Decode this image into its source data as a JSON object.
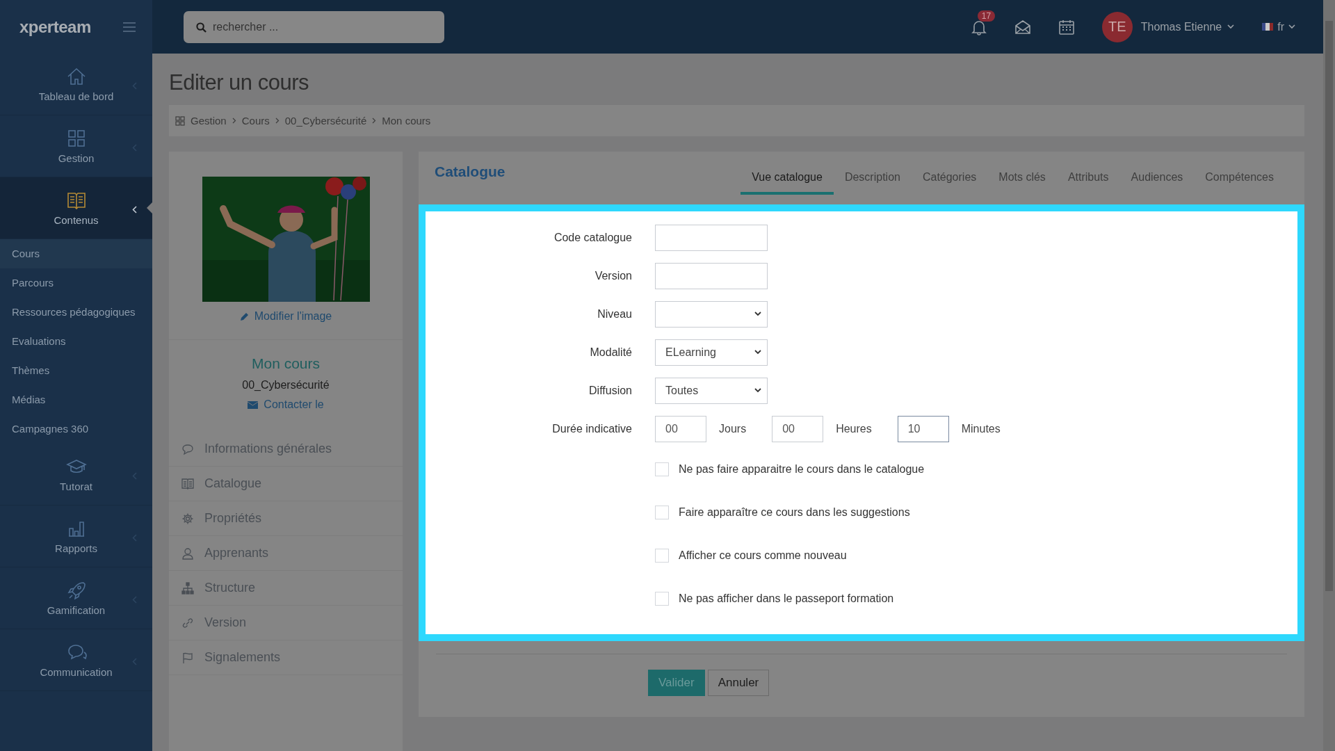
{
  "topbar": {
    "logo": "xperteam",
    "search": {
      "placeholder": "rechercher ..."
    },
    "notifications": "17",
    "user": {
      "initials": "TE",
      "name": "Thomas Etienne"
    },
    "language": "fr"
  },
  "sidebar": {
    "items": [
      {
        "label": "Tableau de bord",
        "expanded": false
      },
      {
        "label": "Gestion",
        "expanded": false
      },
      {
        "label": "Contenus",
        "expanded": true,
        "children": [
          {
            "label": "Cours",
            "selected": true
          },
          {
            "label": "Parcours",
            "selected": false
          },
          {
            "label": "Ressources pédagogiques",
            "selected": false
          },
          {
            "label": "Evaluations",
            "selected": false
          },
          {
            "label": "Thèmes",
            "selected": false
          },
          {
            "label": "Médias",
            "selected": false
          },
          {
            "label": "Campagnes 360",
            "selected": false
          }
        ]
      },
      {
        "label": "Tutorat",
        "expanded": false
      },
      {
        "label": "Rapports",
        "expanded": false
      },
      {
        "label": "Gamification",
        "expanded": false
      },
      {
        "label": "Communication",
        "expanded": false
      }
    ]
  },
  "page": {
    "title": "Editer un cours",
    "breadcrumb": [
      "Gestion",
      "Cours",
      "00_Cybersécurité",
      "Mon cours"
    ]
  },
  "course_card": {
    "edit_link": "Modifier l'image",
    "title": "Mon cours",
    "category": "00_Cybersécurité",
    "contact": "Contacter le",
    "menu": [
      "Informations générales",
      "Catalogue",
      "Propriétés",
      "Apprenants",
      "Structure",
      "Version",
      "Signalements"
    ]
  },
  "panel": {
    "heading": "Catalogue",
    "highlighted": true,
    "tabs": [
      {
        "label": "Vue catalogue",
        "selected": true
      },
      {
        "label": "Description",
        "selected": false
      },
      {
        "label": "Catégories",
        "selected": false
      },
      {
        "label": "Mots clés",
        "selected": false
      },
      {
        "label": "Attributs",
        "selected": false
      },
      {
        "label": "Audiences",
        "selected": false
      },
      {
        "label": "Compétences",
        "selected": false
      }
    ],
    "fields": [
      {
        "kind": "text",
        "label": "Code catalogue"
      },
      {
        "kind": "text",
        "label": "Version"
      },
      {
        "kind": "select",
        "label": "Niveau"
      },
      {
        "kind": "select",
        "label": "Modalité",
        "value": "ELearning"
      },
      {
        "kind": "select",
        "label": "Diffusion",
        "value": "Toutes"
      },
      {
        "kind": "duration",
        "label": "Durée indicative",
        "parts": [
          {
            "value": "00",
            "unit": "Jours"
          },
          {
            "value": "00",
            "unit": "Heures"
          },
          {
            "value": "10",
            "unit": "Minutes"
          }
        ]
      }
    ],
    "checkboxes": [
      {
        "label": "Ne pas faire apparaitre le cours dans le catalogue",
        "checked": false
      },
      {
        "label": "Faire apparaître ce cours dans les suggestions",
        "checked": false
      },
      {
        "label": "Afficher ce cours comme nouveau",
        "checked": false
      },
      {
        "label": "Ne pas afficher dans le passeport formation",
        "checked": false
      }
    ],
    "buttons": [
      {
        "label": "Valider",
        "kind": "primary"
      },
      {
        "label": "Annuler",
        "kind": "default"
      }
    ]
  }
}
